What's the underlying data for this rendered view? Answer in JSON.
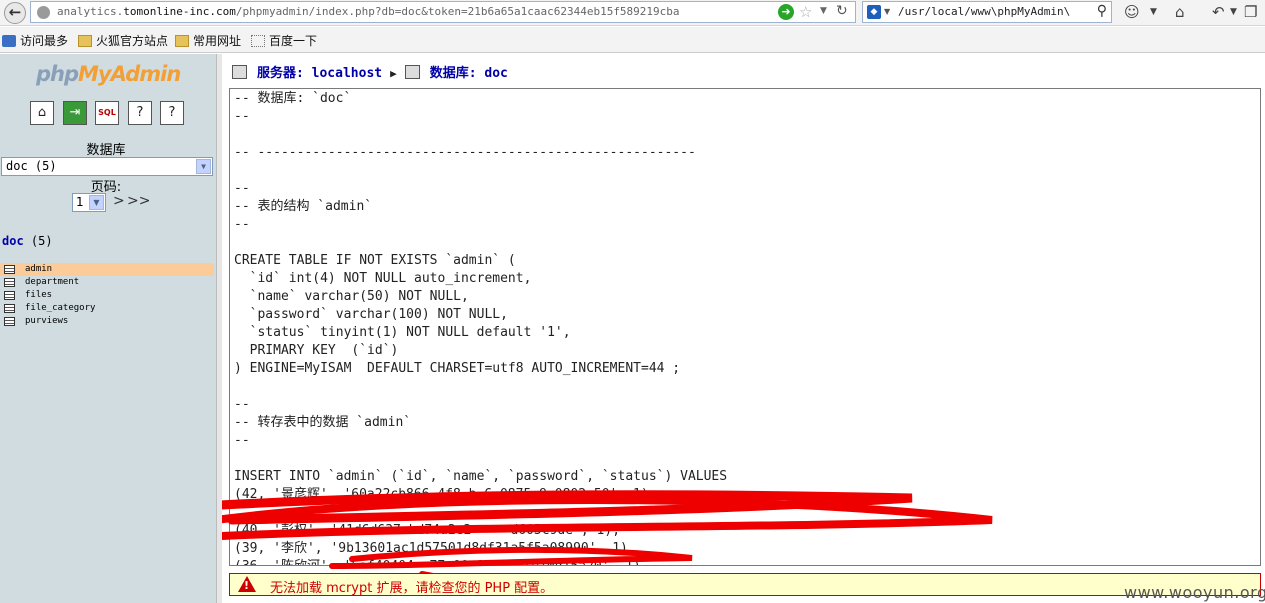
{
  "browser": {
    "url_prefix": "analytics.",
    "url_host": "tomonline-inc.com",
    "url_path": "/phpmyadmin/index.php?db=doc&token=21b6a65a1caac62344eb15f589219cba",
    "search_text": "/usr/local/www\\phpMyAdmin\\",
    "icons": [
      "back-icon",
      "globe-icon",
      "go-icon",
      "star-icon",
      "dropdown-icon",
      "reload-icon",
      "search-engine-icon",
      "search-icon",
      "smiley-icon",
      "home-icon",
      "undo-icon",
      "restore-window-icon"
    ]
  },
  "bookmarks": [
    {
      "label": "访问最多",
      "icon": "blue"
    },
    {
      "label": "火狐官方站点",
      "icon": "folder"
    },
    {
      "label": "常用网址",
      "icon": "folder"
    },
    {
      "label": "百度一下",
      "icon": "dotted"
    }
  ],
  "sidebar": {
    "logo_php": "php",
    "logo_my": "MyAdmin",
    "db_label": "数据库",
    "db_select_value": "doc (5)",
    "page_label": "页码:",
    "page_value": "1",
    "page_next": ">",
    "page_last": ">>",
    "db_name": "doc",
    "db_count": " (5)",
    "tables": [
      "admin",
      "department",
      "files",
      "file_category",
      "purviews"
    ],
    "active_table": "admin"
  },
  "main": {
    "server_label": "服务器: localhost",
    "database_label": "数据库: doc",
    "sql_lines": [
      "-- 数据库: `doc`",
      "--",
      "",
      "-- --------------------------------------------------------",
      "",
      "--",
      "-- 表的结构 `admin`",
      "--",
      "",
      "CREATE TABLE IF NOT EXISTS `admin` (",
      "  `id` int(4) NOT NULL auto_increment,",
      "  `name` varchar(50) NOT NULL,",
      "  `password` varchar(100) NOT NULL,",
      "  `status` tinyint(1) NOT NULL default '1',",
      "  PRIMARY KEY  (`id`)",
      ") ENGINE=MyISAM  DEFAULT CHARSET=utf8 AUTO_INCREMENT=44 ;",
      "",
      "--",
      "-- 转存表中的数据 `admin`",
      "--",
      "",
      "INSERT INTO `admin` (`id`, `name`, `password`, `status`) VALUES",
      "(42, '景彦辉', '60a22cb866 4f8 b 6 0875 9 0802a50', 1),",
      "",
      "(40, '彭权', '41d6d637abd74a2e2     d605c9de', 1),",
      "(39, '李欣', '9b13601ac1d57501d8df31a5f5a08990', 1),",
      "(36, '陈欣河', '5af40404cc77a00c16323ffe10d15a20', 1)"
    ],
    "error_text": "无法加载 mcrypt 扩展，请检查您的 PHP 配置。"
  },
  "watermark": "www.wooyun.org",
  "colors": {
    "sidebar_bg": "#d0dce0",
    "active_table_bg": "#fbcc99",
    "link_blue": "#0000aa",
    "error_red": "#cc0000",
    "error_bg": "#ffffcc",
    "scribble_red": "#ee0000"
  }
}
